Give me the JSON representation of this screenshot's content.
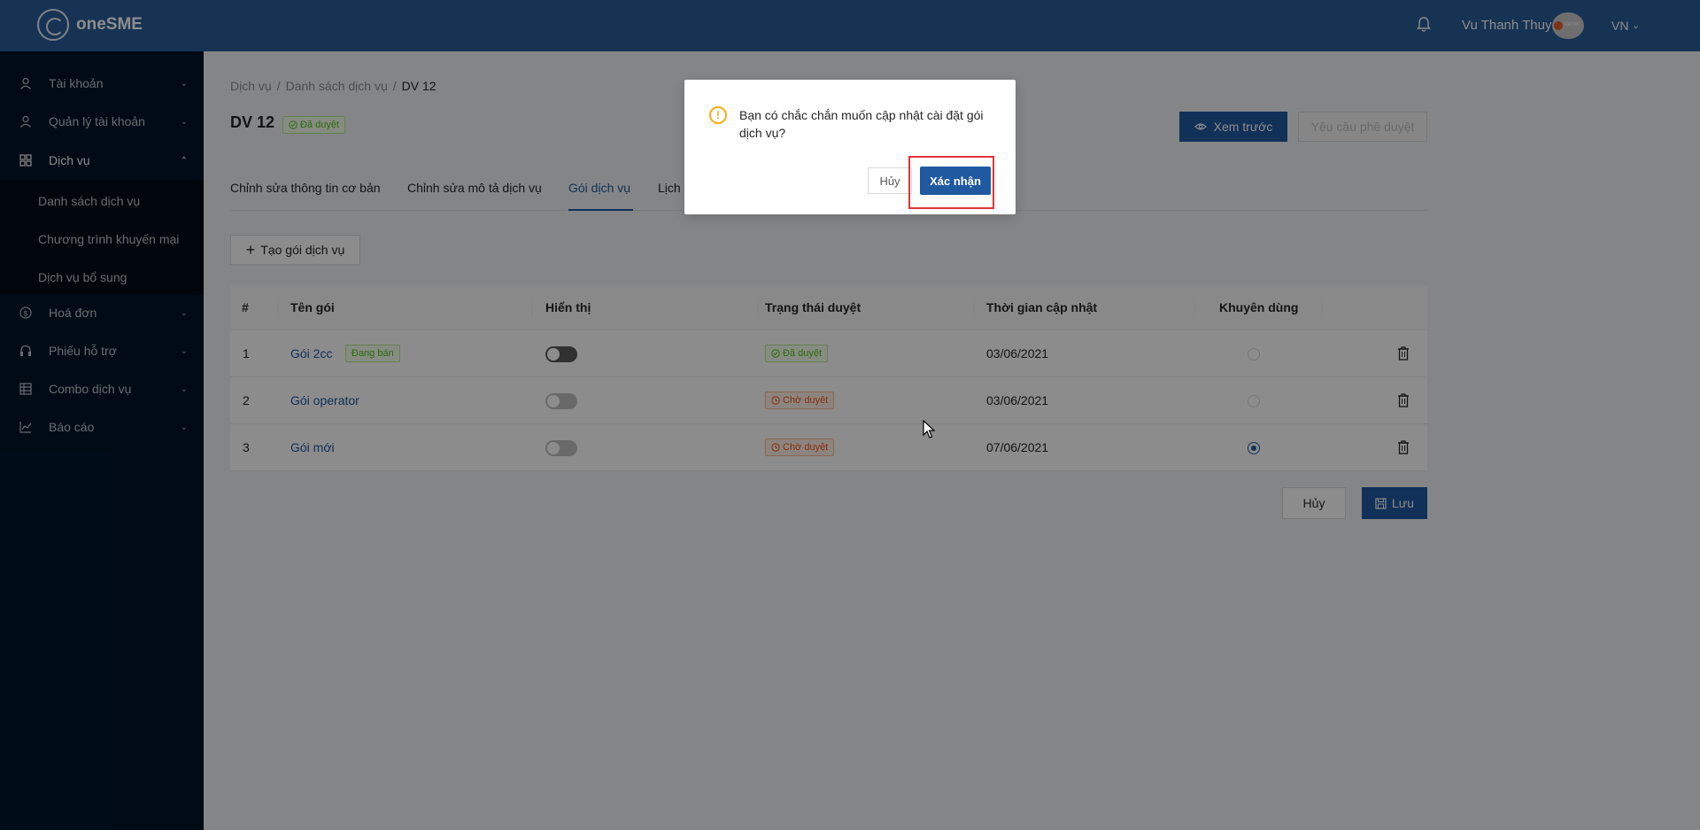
{
  "header": {
    "app_name": "oneSME",
    "username": "Vu Thanh Thuy",
    "language": "VN"
  },
  "sidebar": {
    "items": [
      {
        "label": "Tài khoản",
        "icon": "user-icon"
      },
      {
        "label": "Quản lý tài khoản",
        "icon": "user-icon"
      },
      {
        "label": "Dịch vụ",
        "icon": "grid-icon"
      },
      {
        "label": "Hoá đơn",
        "icon": "dollar-icon"
      },
      {
        "label": "Phiếu hỗ trợ",
        "icon": "headset-icon"
      },
      {
        "label": "Combo dịch vụ",
        "icon": "table-icon"
      },
      {
        "label": "Báo cáo",
        "icon": "line-chart-icon"
      }
    ],
    "subitems": [
      "Danh sách dịch vụ",
      "Chương trình khuyến mại",
      "Dịch vụ bổ sung"
    ]
  },
  "breadcrumb": [
    "Dịch vụ",
    "Danh sách dịch vụ",
    "DV 12"
  ],
  "page": {
    "title": "DV 12",
    "status": "Đã duyệt",
    "preview_label": "Xem trước",
    "approve_label": "Yêu cầu phê duyệt"
  },
  "tabs": [
    "Chỉnh sửa thông tin cơ bản",
    "Chỉnh sửa mô tả dịch vụ",
    "Gói dịch vụ",
    "Lịch"
  ],
  "create_label": "Tạo gói dịch vụ",
  "table": {
    "headers": [
      "#",
      "Tên gói",
      "Hiển thị",
      "Trạng thái duyệt",
      "Thời gian cập nhật",
      "Khuyên dùng"
    ],
    "rows": [
      {
        "index": "1",
        "name": "Gói 2cc",
        "tag": "Đang bán",
        "status": "Đã duyệt",
        "updated": "03/06/2021",
        "display_on": true,
        "recommended": false
      },
      {
        "index": "2",
        "name": "Gói operator",
        "status": "Chờ duyệt",
        "updated": "03/06/2021",
        "display_on": false,
        "recommended": false
      },
      {
        "index": "3",
        "name": "Gói mới",
        "status": "Chờ duyệt",
        "updated": "07/06/2021",
        "display_on": false,
        "recommended": true
      }
    ]
  },
  "footer": {
    "cancel_label": "Hủy",
    "save_label": "Lưu"
  },
  "modal": {
    "message": "Bạn có chắc chắn muốn cập nhật cài đặt gói dịch vụ?",
    "cancel_label": "Hủy",
    "confirm_label": "Xác nhận"
  },
  "colors": {
    "primary": "#1f5aa0",
    "header": "#2a5d9a",
    "sidebar": "#001529",
    "approved": "#52c41a",
    "pending": "#fa541c",
    "warning": "#faad14",
    "highlight": "#e0343a"
  }
}
